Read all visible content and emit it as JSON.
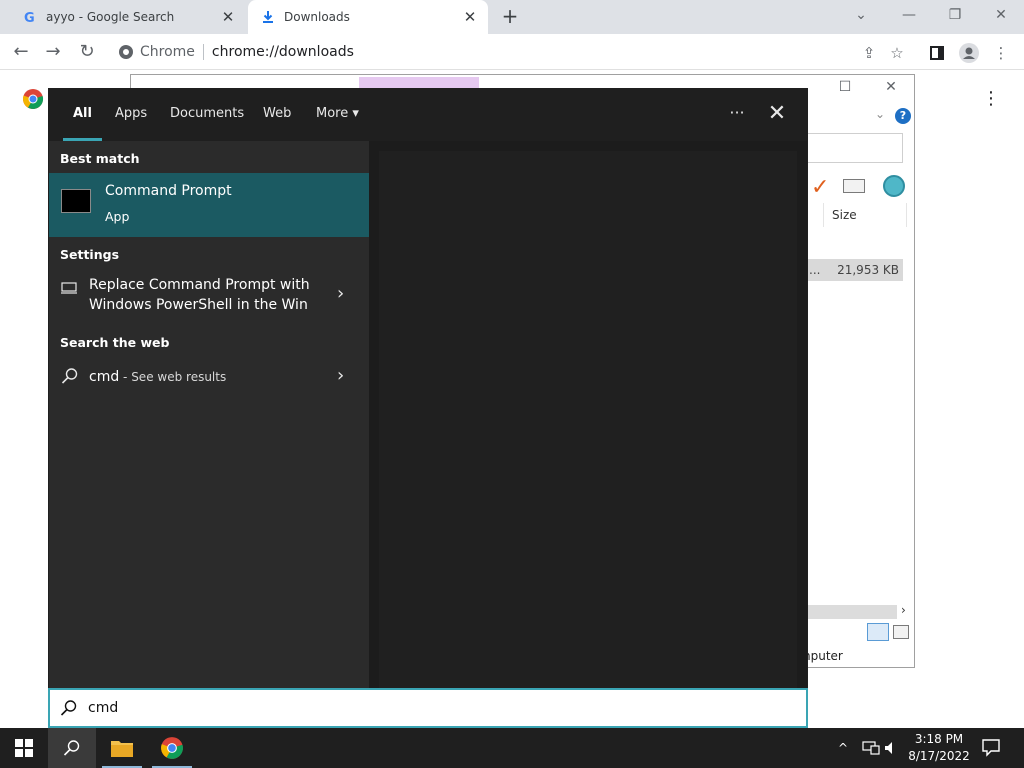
{
  "browser": {
    "tabs": [
      {
        "title": "ayyo - Google Search",
        "favicon": "google-g-icon"
      },
      {
        "title": "Downloads",
        "favicon": "download-icon"
      }
    ],
    "new_tab": "+",
    "window_controls": {
      "minimize": "—",
      "restore": "❐",
      "close": "✕",
      "tab_search": "⌄"
    },
    "omnibox": {
      "site_label": "Chrome",
      "url": "chrome://downloads"
    }
  },
  "explorer_window": {
    "column_header": "Size",
    "row_size": "21,953 KB",
    "row_prefix": "...",
    "status_text": "nputer",
    "help_label": "?"
  },
  "search_panel": {
    "tabs": [
      "All",
      "Apps",
      "Documents",
      "Web",
      "More"
    ],
    "more_caret": "▾",
    "ellipsis": "···",
    "close": "✕",
    "sections": {
      "best_match": "Best match",
      "settings": "Settings",
      "search_web": "Search the web"
    },
    "best_match": {
      "name": "Command Prompt",
      "type": "App"
    },
    "settings_result": {
      "line1": "Replace Command Prompt with",
      "line2": "Windows PowerShell in the Win"
    },
    "web_result": {
      "query": "cmd",
      "suffix": " - See web results"
    },
    "query": "cmd"
  },
  "taskbar": {
    "time": "3:18 PM",
    "date": "8/17/2022",
    "tray_chevron": "^"
  },
  "colors": {
    "accent": "#3aa5b4",
    "best_match_bg": "#1b5a62",
    "panel_bg": "#2b2b2b",
    "taskbar_bg": "#1f1f1f"
  }
}
